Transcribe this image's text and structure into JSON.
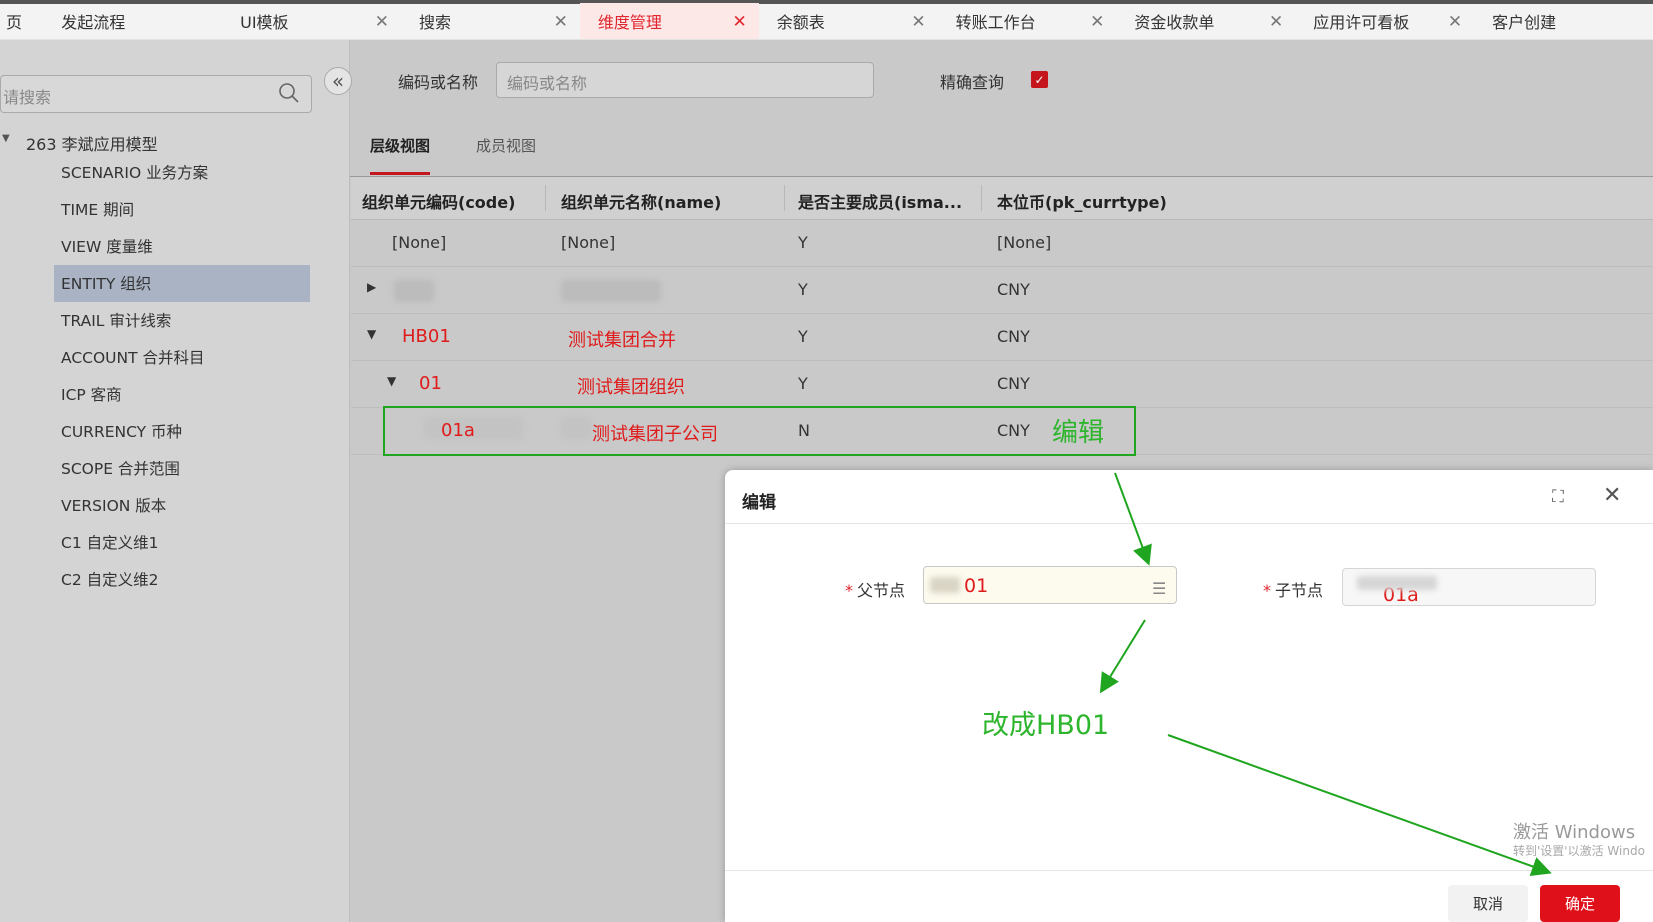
{
  "tabs": [
    {
      "label": "页",
      "closable": false
    },
    {
      "label": "发起流程",
      "closable": false
    },
    {
      "label": "UI模板",
      "closable": true
    },
    {
      "label": "搜索",
      "closable": true
    },
    {
      "label": "维度管理",
      "closable": true,
      "active": true
    },
    {
      "label": "余额表",
      "closable": true
    },
    {
      "label": "转账工作台",
      "closable": true
    },
    {
      "label": "资金收款单",
      "closable": true
    },
    {
      "label": "应用许可看板",
      "closable": true
    },
    {
      "label": "客户创建",
      "closable": false
    }
  ],
  "sidebar": {
    "search_placeholder": "请搜索",
    "root": "263 李斌应用模型",
    "items": [
      "SCENARIO 业务方案",
      "TIME 期间",
      "VIEW 度量维",
      "ENTITY 组织",
      "TRAIL 审计线索",
      "ACCOUNT 合并科目",
      "ICP 客商",
      "CURRENCY 币种",
      "SCOPE 合并范围",
      "VERSION 版本",
      "C1 自定义维1",
      "C2 自定义维2"
    ],
    "selected_index": 3
  },
  "filter": {
    "label": "编码或名称",
    "placeholder": "编码或名称",
    "exact_label": "精确查询",
    "exact_checked": true
  },
  "view_tabs": {
    "hierarchy": "层级视图",
    "members": "成员视图"
  },
  "table": {
    "headers": [
      "组织单元编码(code)",
      "组织单元名称(name)",
      "是否主要成员(isma...",
      "本位币(pk_currtype)"
    ],
    "rows": [
      {
        "code": "[None]",
        "name": "[None]",
        "primary": "Y",
        "currency": "[None]"
      },
      {
        "code": "",
        "name": "",
        "primary": "Y",
        "currency": "CNY"
      },
      {
        "code": "HB01",
        "name": "测试集团合并",
        "primary": "Y",
        "currency": "CNY"
      },
      {
        "code": "01",
        "name": "测试集团组织",
        "primary": "Y",
        "currency": "CNY"
      },
      {
        "code": "01a",
        "name": "测试集团子公司",
        "primary": "N",
        "currency": "CNY"
      }
    ]
  },
  "annotations": {
    "edit": "编辑",
    "change": "改成HB01"
  },
  "dialog": {
    "title": "编辑",
    "parent_label": "父节点",
    "parent_value": "01",
    "child_label": "子节点",
    "child_value": "01a",
    "cancel": "取消",
    "ok": "确定"
  },
  "watermark": {
    "line1": "激活 Windows",
    "line2": "转到'设置'以激活 Windo"
  },
  "colors": {
    "accent": "#e0101a",
    "annotation": "#2db52d",
    "selected": "#a9b3c4"
  }
}
